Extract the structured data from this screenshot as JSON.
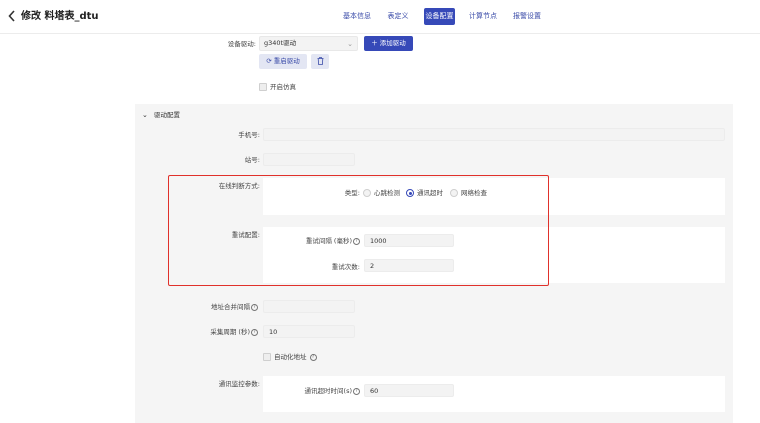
{
  "header": {
    "title": "修改 料塔表_dtu",
    "tabs": [
      {
        "label": "基本信息",
        "active": false
      },
      {
        "label": "表定义",
        "active": false
      },
      {
        "label": "设备配置",
        "active": true
      },
      {
        "label": "计算节点",
        "active": false
      },
      {
        "label": "报警设置",
        "active": false
      }
    ]
  },
  "device": {
    "driver_label": "设备驱动:",
    "driver_value": "g340t驱动",
    "add_driver": "添加驱动",
    "restart_driver": "重启驱动",
    "simulation_label": "开启仿真"
  },
  "driver_config": {
    "section_title": "驱动配置",
    "phone_label": "手机号:",
    "phone_value": "",
    "station_label": "站号:",
    "station_value": "",
    "online_mode_label": "在线判断方式:",
    "type_label": "类型:",
    "type_options": [
      {
        "label": "心跳检测",
        "selected": false
      },
      {
        "label": "通讯超时",
        "selected": true
      },
      {
        "label": "网络检查",
        "selected": false
      }
    ],
    "retry_label": "重试配置:",
    "retry_interval_label": "重试间隔 (毫秒)",
    "retry_interval_value": "1000",
    "retry_count_label": "重试次数:",
    "retry_count_value": "2",
    "addr_merge_label": "地址合并间隔",
    "addr_merge_value": "",
    "collect_period_label": "采集周期 (秒)",
    "collect_period_value": "10",
    "auto_addr_label": "自动化地址",
    "comm_monitor_label": "通讯监控参数:",
    "comm_timeout_label": "通讯超时时间(s)",
    "comm_timeout_value": "60"
  },
  "colors": {
    "primary": "#3649b8",
    "highlight_border": "#e0312b",
    "panel_bg": "#f5f5f5"
  }
}
